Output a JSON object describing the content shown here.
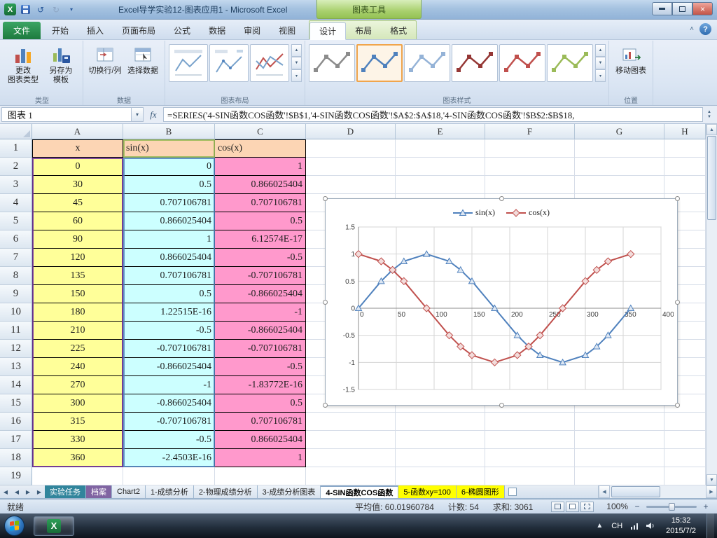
{
  "window": {
    "title": "Excel导学实验12-图表应用1 - Microsoft Excel",
    "contextual_title": "图表工具"
  },
  "icons": {
    "excel": "X",
    "undo": "↺",
    "redo": "↻",
    "dropdown": "▾",
    "close": "×",
    "help": "?",
    "collapse_ribbon": "˄",
    "fx": "fx",
    "left_arrow": "◀",
    "right_arrow": "▶",
    "up_arrow": "▲",
    "down_arrow": "▼"
  },
  "ribbon": {
    "file_tab": "文件",
    "tabs": [
      "开始",
      "插入",
      "页面布局",
      "公式",
      "数据",
      "审阅",
      "视图"
    ],
    "contextual_tabs": [
      {
        "label": "设计",
        "active": true
      },
      {
        "label": "布局",
        "active": false
      },
      {
        "label": "格式",
        "active": false
      }
    ],
    "groups": {
      "type": {
        "label": "类型",
        "buttons": [
          "更改\n图表类型",
          "另存为\n模板"
        ]
      },
      "data": {
        "label": "数据",
        "buttons": [
          "切换行/列",
          "选择数据"
        ]
      },
      "layouts": {
        "label": "图表布局"
      },
      "styles": {
        "label": "图表样式"
      },
      "location": {
        "label": "位置",
        "buttons": [
          "移动图表"
        ]
      }
    },
    "chart_styles": [
      {
        "color": "#8c8c8c",
        "selected": false
      },
      {
        "color": "#4f81bd",
        "selected": true
      },
      {
        "color": "#95b3d7",
        "selected": false
      },
      {
        "color": "#953735",
        "selected": false
      },
      {
        "color": "#c0504d",
        "selected": false
      },
      {
        "color": "#9bbb59",
        "selected": false
      }
    ]
  },
  "formula_bar": {
    "name_box": "图表 1",
    "formula": "=SERIES('4-SIN函数COS函数'!$B$1,'4-SIN函数COS函数'!$A$2:$A$18,'4-SIN函数COS函数'!$B$2:$B$18,"
  },
  "grid": {
    "columns": [
      "A",
      "B",
      "C",
      "D",
      "E",
      "F",
      "G",
      "H"
    ],
    "row_count": 19
  },
  "cell_fills": {
    "header_row": "#fcd5b4",
    "x_column": "#ffff99",
    "sin_column": "#ccffff",
    "cos_column": "#ff99cc"
  },
  "table": {
    "headers": [
      "x",
      "sin(x)",
      "cos(x)"
    ],
    "rows": [
      [
        "0",
        "0",
        "1"
      ],
      [
        "30",
        "0.5",
        "0.866025404"
      ],
      [
        "45",
        "0.707106781",
        "0.707106781"
      ],
      [
        "60",
        "0.866025404",
        "0.5"
      ],
      [
        "90",
        "1",
        "6.12574E-17"
      ],
      [
        "120",
        "0.866025404",
        "-0.5"
      ],
      [
        "135",
        "0.707106781",
        "-0.707106781"
      ],
      [
        "150",
        "0.5",
        "-0.866025404"
      ],
      [
        "180",
        "1.22515E-16",
        "-1"
      ],
      [
        "210",
        "-0.5",
        "-0.866025404"
      ],
      [
        "225",
        "-0.707106781",
        "-0.707106781"
      ],
      [
        "240",
        "-0.866025404",
        "-0.5"
      ],
      [
        "270",
        "-1",
        "-1.83772E-16"
      ],
      [
        "300",
        "-0.866025404",
        "0.5"
      ],
      [
        "315",
        "-0.707106781",
        "0.707106781"
      ],
      [
        "330",
        "-0.5",
        "0.866025404"
      ],
      [
        "360",
        "-2.4503E-16",
        "1"
      ]
    ]
  },
  "chart_data": {
    "type": "line",
    "x": [
      0,
      30,
      45,
      60,
      90,
      120,
      135,
      150,
      180,
      210,
      225,
      240,
      270,
      300,
      315,
      330,
      360
    ],
    "series": [
      {
        "name": "sin(x)",
        "color": "#4f81bd",
        "marker": "triangle",
        "marker_fill": "#dce6f2",
        "values": [
          0,
          0.5,
          0.707106781,
          0.866025404,
          1,
          0.866025404,
          0.707106781,
          0.5,
          0,
          -0.5,
          -0.707106781,
          -0.866025404,
          -1,
          -0.866025404,
          -0.707106781,
          -0.5,
          0
        ]
      },
      {
        "name": "cos(x)",
        "color": "#c0504d",
        "marker": "diamond",
        "marker_fill": "#f2dcdb",
        "values": [
          1,
          0.866025404,
          0.707106781,
          0.5,
          0,
          -0.5,
          -0.707106781,
          -0.866025404,
          -1,
          -0.866025404,
          -0.707106781,
          -0.5,
          0,
          0.5,
          0.707106781,
          0.866025404,
          1
        ]
      }
    ],
    "xlim": [
      0,
      400
    ],
    "ylim": [
      -1.5,
      1.5
    ],
    "x_ticks": [
      0,
      50,
      100,
      150,
      200,
      250,
      300,
      350,
      400
    ],
    "y_ticks": [
      -1.5,
      -1,
      -0.5,
      0,
      0.5,
      1,
      1.5
    ],
    "grid": true,
    "legend_position": "top"
  },
  "sheets": {
    "tabs": [
      {
        "label": "实验任务",
        "bg": "#31859c",
        "fg": "#ffffff",
        "active": false
      },
      {
        "label": "档案",
        "bg": "#8064a2",
        "fg": "#ffffff",
        "active": false
      },
      {
        "label": "Chart2",
        "bg": "",
        "fg": "",
        "active": false
      },
      {
        "label": "1-成绩分析",
        "bg": "",
        "fg": "",
        "active": false
      },
      {
        "label": "2-物理成绩分析",
        "bg": "",
        "fg": "",
        "active": false
      },
      {
        "label": "3-成绩分析图表",
        "bg": "",
        "fg": "",
        "active": false
      },
      {
        "label": "4-SIN函数COS函数",
        "bg": "",
        "fg": "",
        "active": true
      },
      {
        "label": "5-函数xy=100",
        "bg": "#ffff00",
        "fg": "#000000",
        "active": false
      },
      {
        "label": "6-椭圆图形",
        "bg": "#ffff00",
        "fg": "#000000",
        "active": false
      }
    ]
  },
  "status_bar": {
    "mode": "就绪",
    "average": "平均值: 60.01960784",
    "count": "计数: 54",
    "sum": "求和: 3061",
    "zoom": "100%"
  },
  "taskbar": {
    "lang": "CH",
    "time": "15:32",
    "date": "2015/7/2"
  }
}
